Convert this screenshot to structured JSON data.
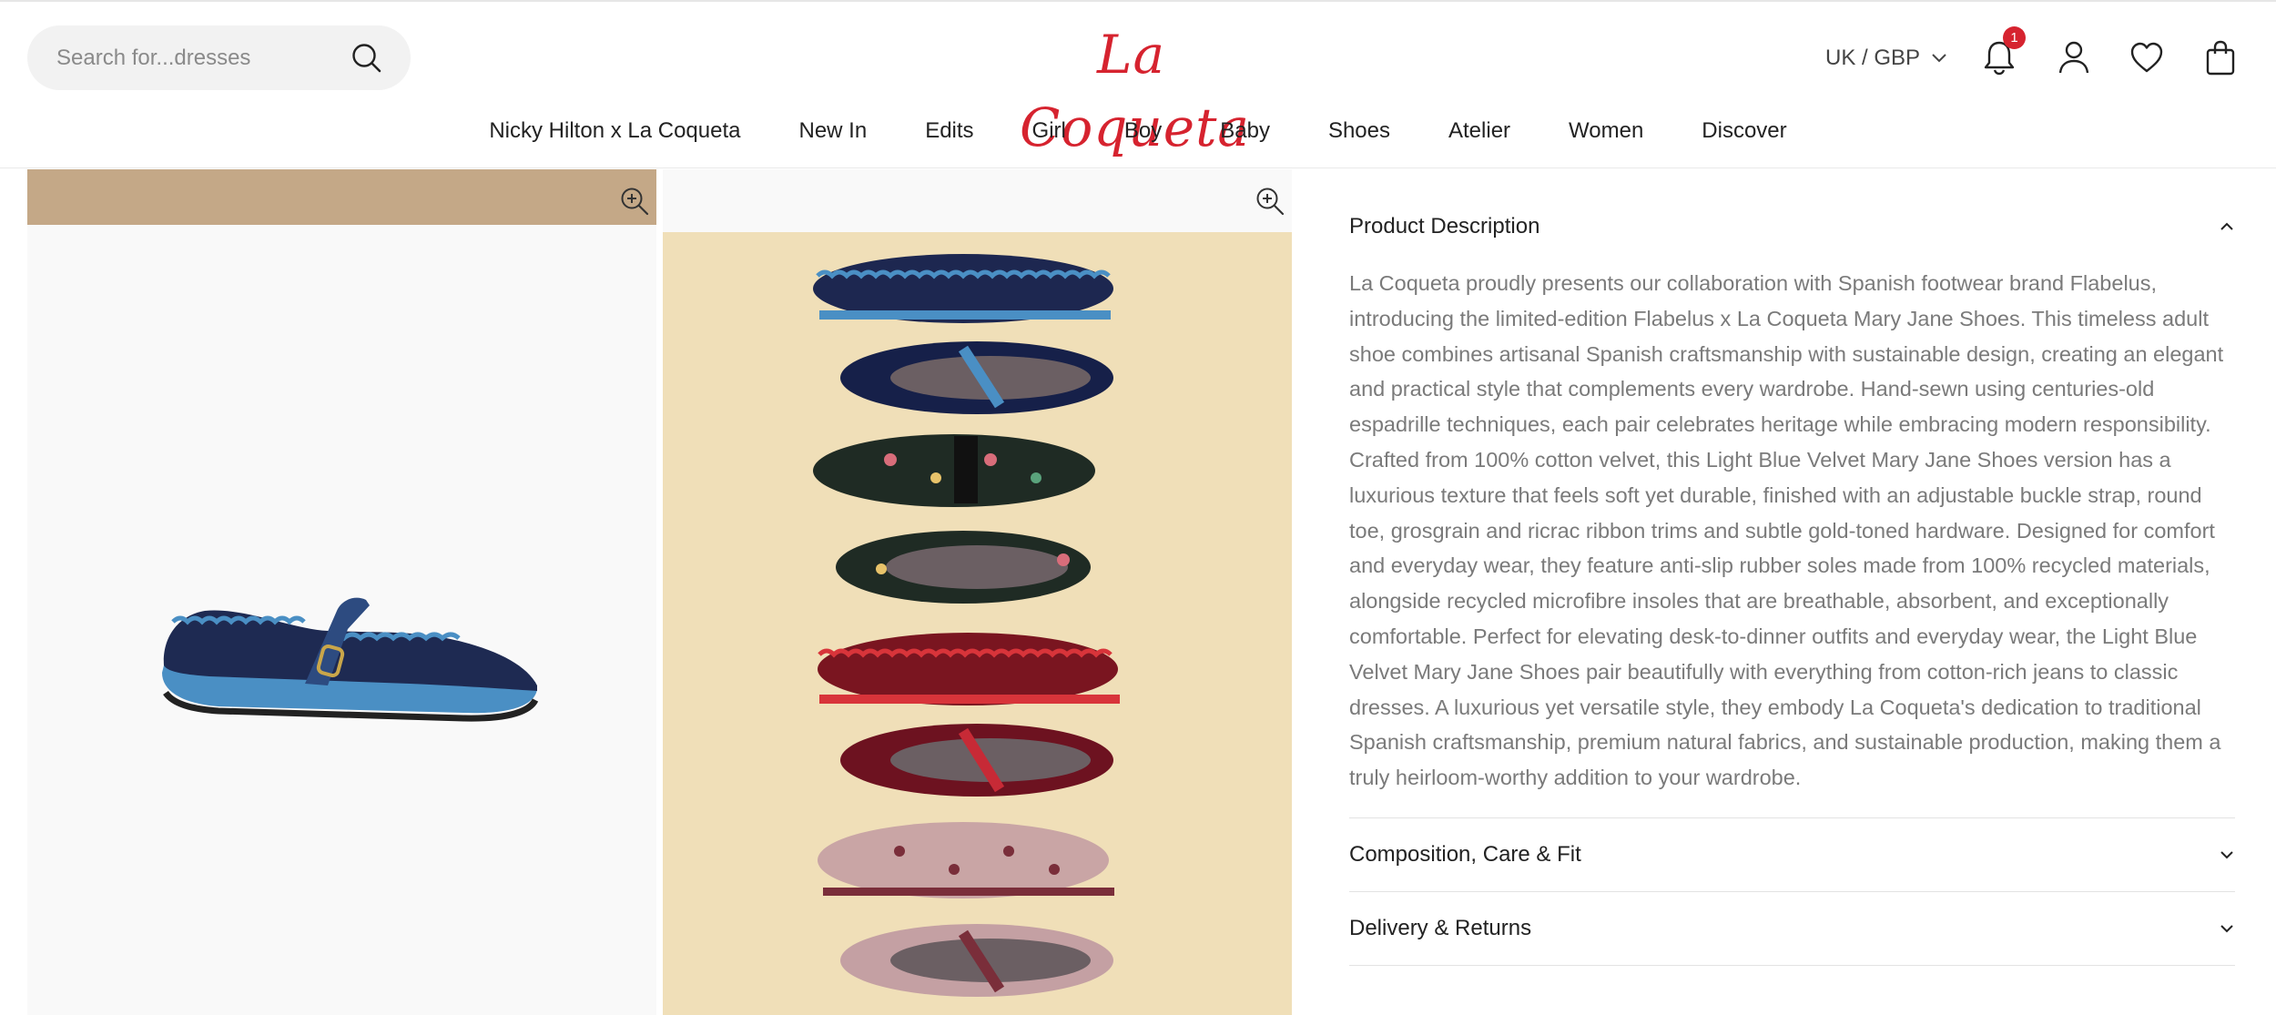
{
  "search": {
    "placeholder": "Search for...dresses"
  },
  "brand": {
    "logo": "La Coqueta",
    "color": "#d6232f"
  },
  "header": {
    "locale": "UK / GBP",
    "notifications_count": "1",
    "icons": [
      "bell-icon",
      "account-icon",
      "heart-icon",
      "bag-icon"
    ]
  },
  "nav": {
    "items": [
      "Nicky Hilton x La Coqueta",
      "New In",
      "Edits",
      "Girl",
      "Boy",
      "Baby",
      "Shoes",
      "Atelier",
      "Women",
      "Discover"
    ]
  },
  "gallery": {
    "images": [
      {
        "alt": "Navy velvet Mary Jane shoe with light blue trim"
      },
      {
        "alt": "Stack of Mary Jane shoes in navy, floral, red and pink"
      }
    ]
  },
  "accordion": {
    "product_description": {
      "title": "Product Description",
      "text": "La Coqueta proudly presents our collaboration with Spanish footwear brand Flabelus, introducing the limited-edition Flabelus x La Coqueta Mary Jane Shoes. This timeless adult shoe combines artisanal Spanish craftsmanship with sustainable design, creating an elegant and practical style that complements every wardrobe. Hand-sewn using centuries-old espadrille techniques, each pair celebrates heritage while embracing modern responsibility. Crafted from 100% cotton velvet, this Light Blue Velvet Mary Jane Shoes version has a luxurious texture that feels soft yet durable, finished with an adjustable buckle strap, round toe, grosgrain and ricrac ribbon trims and subtle gold-toned hardware. Designed for comfort and everyday wear, they feature anti-slip rubber soles made from 100% recycled materials, alongside recycled microfibre insoles that are breathable, absorbent, and exceptionally comfortable. Perfect for elevating desk-to-dinner outfits and everyday wear, the Light Blue Velvet Mary Jane Shoes pair beautifully with everything from cotton-rich jeans to classic dresses. A luxurious yet versatile style, they embody La Coqueta's dedication to traditional Spanish craftsmanship, premium natural fabrics, and sustainable production, making them a truly heirloom-worthy addition to your wardrobe."
    },
    "composition": {
      "title": "Composition, Care & Fit"
    },
    "delivery": {
      "title": "Delivery & Returns"
    }
  }
}
